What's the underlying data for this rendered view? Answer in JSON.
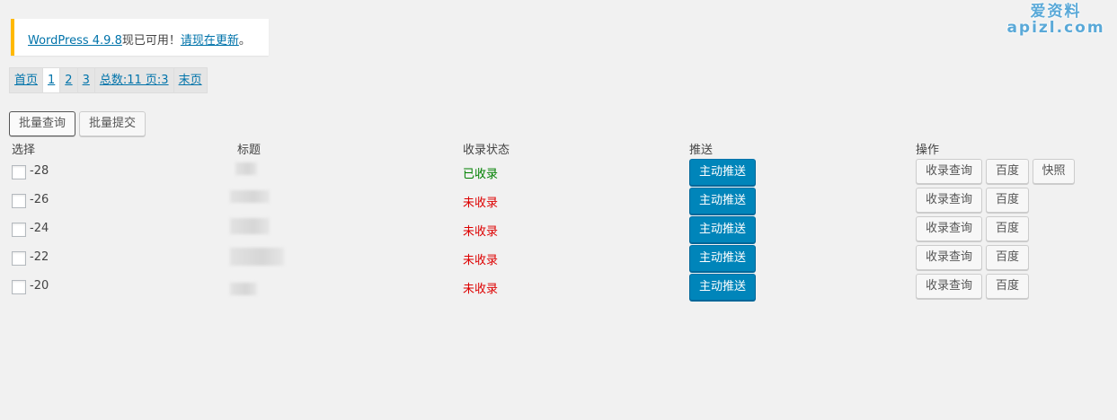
{
  "notice": {
    "version_link": "WordPress 4.9.8",
    "middle_text": "现已可用！",
    "update_link": "请现在更新",
    "suffix": "。"
  },
  "watermark": {
    "top": "爱资料",
    "bottom": "apizl.com"
  },
  "pager": {
    "first": "首页",
    "pages": [
      "1",
      "2",
      "3"
    ],
    "current_page": "1",
    "summary": "总数:11 页:3",
    "last": "末页"
  },
  "toolbar": {
    "batch_query": "批量查询",
    "batch_submit": "批量提交"
  },
  "table": {
    "headers": {
      "select": "选择",
      "title": "标题",
      "status": "收录状态",
      "push": "推送",
      "action": "操作"
    },
    "push_label": "主动推送",
    "query_label": "收录查询",
    "baidu_label": "百度",
    "snapshot_label": "快照",
    "rows": [
      {
        "id": "-28",
        "status": "已收录",
        "status_type": "indexed",
        "has_snapshot": true
      },
      {
        "id": "-26",
        "status": "未收录",
        "status_type": "not_indexed",
        "has_snapshot": false
      },
      {
        "id": "-24",
        "status": "未收录",
        "status_type": "not_indexed",
        "has_snapshot": false
      },
      {
        "id": "-22",
        "status": "未收录",
        "status_type": "not_indexed",
        "has_snapshot": false
      },
      {
        "id": "-20",
        "status": "未收录",
        "status_type": "not_indexed",
        "has_snapshot": false
      }
    ]
  },
  "colors": {
    "accent": "#0085ba",
    "link": "#0073aa",
    "notice_border": "#ffb900",
    "indexed": "#008000",
    "not_indexed": "#dd0000"
  }
}
